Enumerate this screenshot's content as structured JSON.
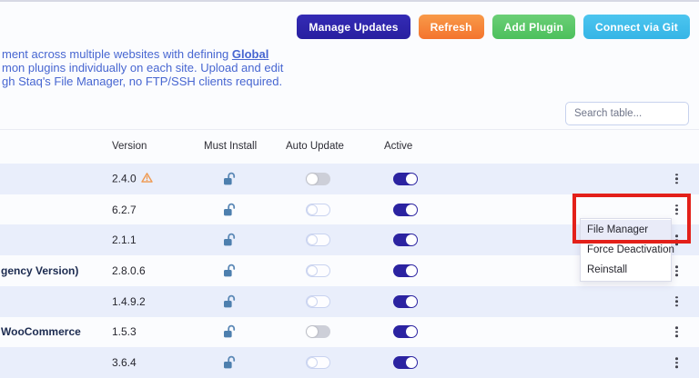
{
  "toolbar": {
    "buttons": [
      {
        "label": "Manage Updates",
        "color": "#2b23a1"
      },
      {
        "label": "Refresh",
        "color": "#f6853a"
      },
      {
        "label": "Add Plugin",
        "color": "#58c767"
      },
      {
        "label": "Connect via Git",
        "color": "#3fbdeb"
      }
    ]
  },
  "description": {
    "line1_fragment": "ment across multiple websites with defining ",
    "link_text": "Global",
    "line2": "mon plugins individually on each site. Upload and edit",
    "line3": "gh Staq's File Manager, no FTP/SSH clients required.",
    "text_color": "#4766d1"
  },
  "search": {
    "placeholder": "Search table..."
  },
  "table": {
    "headers": [
      "Version",
      "Must Install",
      "Auto Update",
      "Active"
    ],
    "rows": [
      {
        "name": "",
        "version": "2.4.0",
        "update_warning": true,
        "must_install": "unlocked",
        "auto_update": "off-disabled",
        "active": true
      },
      {
        "name": "",
        "version": "6.2.7",
        "update_warning": false,
        "must_install": "unlocked",
        "auto_update": "off",
        "active": true
      },
      {
        "name": "",
        "version": "2.1.1",
        "update_warning": false,
        "must_install": "unlocked",
        "auto_update": "off",
        "active": true
      },
      {
        "name": "gency Version)",
        "version": "2.8.0.6",
        "update_warning": false,
        "must_install": "unlocked",
        "auto_update": "off",
        "active": true
      },
      {
        "name": "",
        "version": "1.4.9.2",
        "update_warning": false,
        "must_install": "unlocked",
        "auto_update": "off",
        "active": true
      },
      {
        "name": "WooCommerce",
        "version": "1.5.3",
        "update_warning": false,
        "must_install": "unlocked",
        "auto_update": "off-disabled",
        "active": true
      },
      {
        "name": "",
        "version": "3.6.4",
        "update_warning": false,
        "must_install": "unlocked",
        "auto_update": "off",
        "active": true
      }
    ]
  },
  "context_menu": {
    "items": [
      "File Manager",
      "Force Deactivation",
      "Reinstall"
    ],
    "highlighted_index": 0
  },
  "annotation": {
    "type": "red-highlight-box",
    "color": "#e32019"
  },
  "colors": {
    "row_alt_background": "#e9eefb",
    "toggle_on": "#2b23a1",
    "lock_icon": "#4d7fae",
    "warning_icon": "#ef9950",
    "description_text": "#4766d1"
  }
}
